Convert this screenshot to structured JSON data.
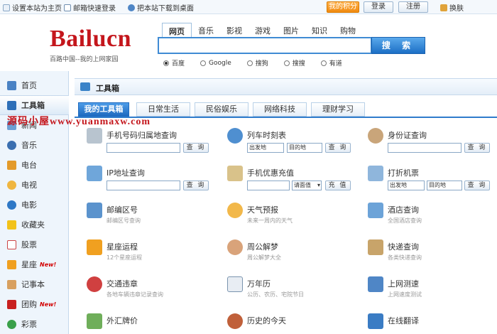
{
  "topbar": {
    "set_home": "设置本站为主页",
    "email_login": "邮箱快速登录",
    "desktop": "把本站下载到桌面",
    "points": "我的积分",
    "login": "登录",
    "register": "注册",
    "skin": "换肤"
  },
  "logo": {
    "name": "Bailucn",
    "slogan": "百路中国--我的上网家园"
  },
  "search": {
    "tabs": [
      "网页",
      "音乐",
      "影视",
      "游戏",
      "图片",
      "知识",
      "购物"
    ],
    "button": "搜 索",
    "engines": [
      "百度",
      "Google",
      "搜狗",
      "搜搜",
      "有道"
    ],
    "selected_engine": "百度"
  },
  "sidebar": {
    "items": [
      {
        "label": "首页",
        "icon": "home-icon",
        "new": ""
      },
      {
        "label": "工具箱",
        "icon": "toolbox-icon",
        "new": ""
      },
      {
        "label": "新闻",
        "icon": "news-icon",
        "new": ""
      },
      {
        "label": "音乐",
        "icon": "music-icon",
        "new": ""
      },
      {
        "label": "电台",
        "icon": "radio-icon",
        "new": ""
      },
      {
        "label": "电视",
        "icon": "tv-icon",
        "new": ""
      },
      {
        "label": "电影",
        "icon": "movie-icon",
        "new": ""
      },
      {
        "label": "收藏夹",
        "icon": "star-icon",
        "new": ""
      },
      {
        "label": "股票",
        "icon": "stock-icon",
        "new": ""
      },
      {
        "label": "星座",
        "icon": "horoscope-icon",
        "new": "New!"
      },
      {
        "label": "记事本",
        "icon": "notepad-icon",
        "new": ""
      },
      {
        "label": "团购",
        "icon": "groupbuy-icon",
        "new": "New!"
      },
      {
        "label": "彩票",
        "icon": "lottery-icon",
        "new": ""
      }
    ]
  },
  "panel": {
    "title": "工具箱",
    "tabs": [
      "我的工具箱",
      "日常生活",
      "民俗娱乐",
      "网络科技",
      "理财学习"
    ]
  },
  "watermark": "源码小屋www.yuanmaxw.com",
  "tools": {
    "phone": {
      "title": "手机号码归属地查询",
      "button": "查 询"
    },
    "train": {
      "title": "列车时刻表",
      "from": "出发地",
      "to": "目的地",
      "button": "查 询"
    },
    "idcard": {
      "title": "身份证查询",
      "button": "查 询"
    },
    "ip": {
      "title": "IP地址查询",
      "button": "查 询"
    },
    "recharge": {
      "title": "手机优惠充值",
      "select": "请面值",
      "button": "充 值"
    },
    "flight": {
      "title": "打折机票",
      "from": "出发地",
      "to": "目的地",
      "button": "查 询"
    },
    "postcode": {
      "title": "邮编区号",
      "desc": "邮编区号查询"
    },
    "weather": {
      "title": "天气预报",
      "desc": "未来一周内的天气"
    },
    "hotel": {
      "title": "酒店查询",
      "desc": "全国酒店查询"
    },
    "horoscope": {
      "title": "星座运程",
      "desc": "12个星座运程"
    },
    "dream": {
      "title": "周公解梦",
      "desc": "周公解梦大全"
    },
    "express": {
      "title": "快递查询",
      "desc": "各类快递查询"
    },
    "traffic": {
      "title": "交通违章",
      "desc": "各地车辆违章记录查询"
    },
    "calendar": {
      "title": "万年历",
      "desc": "公历、农历、宅院节日"
    },
    "speedtest": {
      "title": "上网测速",
      "desc": "上网速度测试"
    },
    "exchange": {
      "title": "外汇牌价"
    },
    "history": {
      "title": "历史的今天"
    },
    "translate": {
      "title": "在线翻译"
    }
  },
  "colors": {
    "brand_red": "#c4161c",
    "accent_blue": "#2f7ccc",
    "sidebar_bg": "#eef5fc"
  }
}
